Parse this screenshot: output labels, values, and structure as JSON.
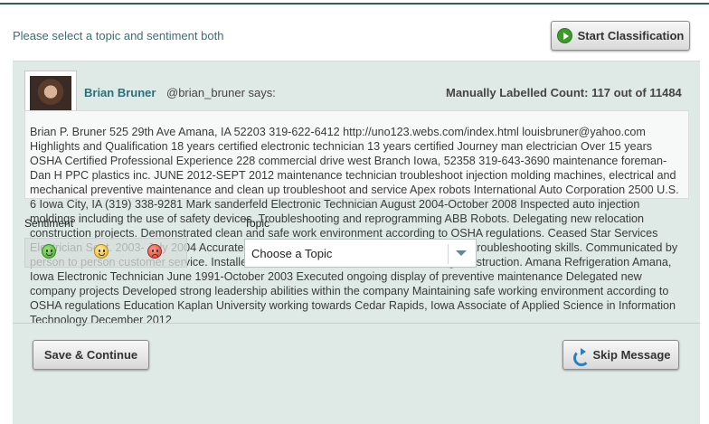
{
  "header": {
    "instruction": "Please select a topic and sentiment both",
    "start_button_label": "Start Classification"
  },
  "message": {
    "user_name": "Brian Bruner",
    "user_handle": "@brian_bruner says:",
    "count_text": "Manually Labelled Count: 117 out of 11484",
    "text": "Brian P. Bruner 525 29th Ave Amana, IA 52203 319-622-6412 http://uno123.webs.com/index.html louisbruner@yahoo.com Highlights and Qualification 18 years certified electronic technician 13 years certified Journey man electrician Over 15 years OSHA Certified Professional Experience 228 commercial drive west Branch Iowa, 52358 319-643-3690 maintenance foreman- Dan H PPC plastics inc. JUNE 2012-SEPT 2012 maintenance technician troubleshoot injection molding machines, electrical and mechanical preventive maintenance and clean up troubleshoot and service Apex robots International Auto Corporation 2500 U.S. 6 Iowa City, IA (319) 338-9281 Mark sanderfeld Electronic Technician August 2004-October 2008 Inspected auto injection moldings including the use of safety devices. Troubleshooting and reprogramming ABB Robots. Delegating new relocation construction projects. Demonstrated clean and safe work environment according to OSHA regulations. Ceased Star Services Electrician Sept. 2003- July 2004 Accurately located and installed Demonstrated helpful troubleshooting skills. Communicated by person to person customer service. Installed CAT 5 network cable for newer housing construction. Amana Refrigeration Amana, Iowa Electronic Technician June 1991-October 2003 Executed ongoing display of preventive maintenance Delegated new company projects Developed strong leadership abilities within the company Maintaining safe working environment according to OSHA regulations Education Kaplan University working towards Cedar Rapids, Iowa Associate of Applied Science in Information Technology December 2012"
  },
  "controls": {
    "sentiment_label": "Sentiment",
    "topic_label": "Topic",
    "topic_selected": "Choose a Topic",
    "sentiment_icons": [
      "smiley-positive-icon",
      "smiley-neutral-icon",
      "smiley-negative-icon"
    ]
  },
  "footer": {
    "save_label": "Save & Continue",
    "skip_label": "Skip Message"
  },
  "colors": {
    "accent_teal": "#2c6e7a",
    "panel_bg": "#dfeae6",
    "positive": "#3fae2c",
    "neutral": "#e6b020",
    "negative": "#d8382a"
  }
}
